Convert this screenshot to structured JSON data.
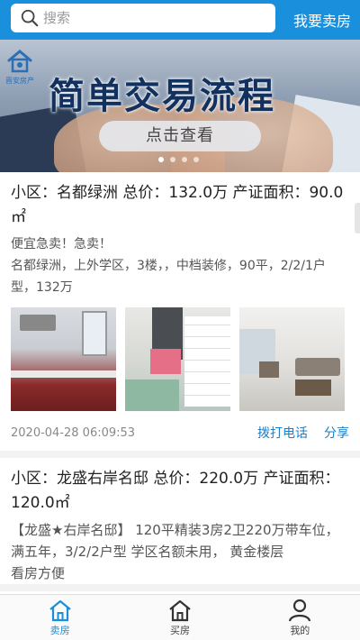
{
  "header": {
    "search_placeholder": "搜索",
    "sell_link": "我要卖房"
  },
  "banner": {
    "logo_text": "晋安房产",
    "title": "简单交易流程",
    "button": "点击查看",
    "dots_count": 4,
    "active_dot": 0
  },
  "listings": [
    {
      "title": "小区：名都绿洲 总价：132.0万 产证面积：90.0㎡",
      "desc": "便宜急卖！急卖！\n名都绿洲，上外学区，3楼，，中档装修，90平，2/2/1户型，132万",
      "photos": [
        "kitchen-photo",
        "bathroom-photo",
        "living-room-photo"
      ],
      "time": "2020-04-28 06:09:53",
      "call_label": "拨打电话",
      "share_label": "分享"
    },
    {
      "title": "小区：龙盛右岸名邸 总价：220.0万 产证面积：120.0㎡",
      "desc": "【龙盛★右岸名邸】 120平精装3房2卫220万带车位，满五年，3/2/2户型 学区名额未用， 黄金楼层\n看房方便"
    }
  ],
  "tabs": [
    {
      "label": "卖房",
      "icon": "home-icon",
      "active": true
    },
    {
      "label": "买房",
      "icon": "house-icon",
      "active": false
    },
    {
      "label": "我的",
      "icon": "user-icon",
      "active": false
    }
  ],
  "colors": {
    "primary": "#1a90dc",
    "link": "#1a7fc7",
    "banner_title": "#12315f"
  }
}
